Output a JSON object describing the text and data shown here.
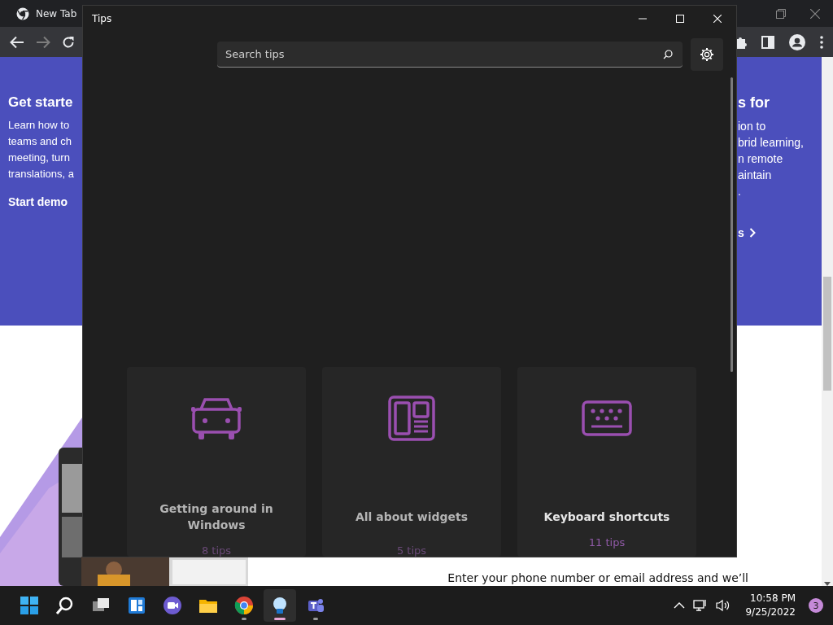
{
  "browser": {
    "tab": {
      "title": "New Tab"
    },
    "back": {
      "disabled": false
    },
    "forward": {
      "disabled": true
    }
  },
  "page": {
    "left_promo": {
      "title": "Get starte",
      "lines": [
        "Learn how to",
        "teams and ch",
        "meeting, turn",
        "translations, a"
      ],
      "link": "Start demo"
    },
    "right_promo": {
      "title": "s for",
      "lines": [
        "ion to",
        "brid learning,",
        "n remote",
        "aintain",
        "."
      ],
      "link": "s"
    },
    "footer_text": "Enter your phone number or email address and we’ll"
  },
  "tips_window": {
    "title": "Tips",
    "search": {
      "placeholder": "Search tips"
    },
    "cards": [
      {
        "title": "Getting around in Windows",
        "count": "8 tips",
        "hovered": false
      },
      {
        "title": "All about widgets",
        "count": "5 tips",
        "hovered": false
      },
      {
        "title": "Keyboard shortcuts",
        "count": "11 tips",
        "hovered": true
      }
    ]
  },
  "taskbar": {
    "apps": [
      {
        "running": false,
        "active": false
      },
      {
        "running": false,
        "active": false
      },
      {
        "running": false,
        "active": false
      },
      {
        "running": false,
        "active": false
      },
      {
        "running": false,
        "active": false
      },
      {
        "running": false,
        "active": false
      },
      {
        "running": true,
        "active": false
      },
      {
        "running": true,
        "active": true
      },
      {
        "running": true,
        "active": false
      }
    ],
    "clock": {
      "time": "10:58 PM",
      "date": "9/25/2022"
    },
    "notification_count": "3"
  }
}
